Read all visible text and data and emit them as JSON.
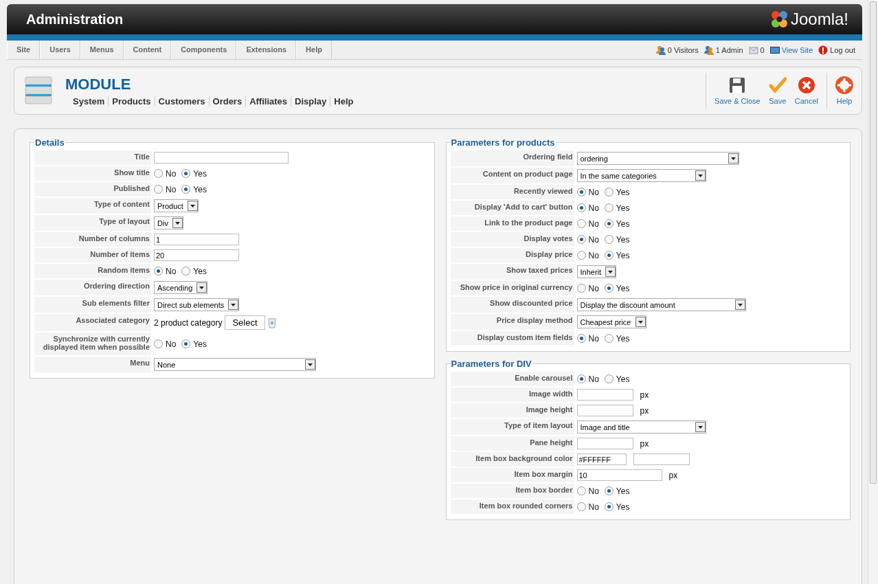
{
  "header": {
    "title": "Administration",
    "logo": "Joomla!"
  },
  "menu": [
    "Site",
    "Users",
    "Menus",
    "Content",
    "Components",
    "Extensions",
    "Help"
  ],
  "status": [
    {
      "kind": "visitors",
      "text": "0 Visitors"
    },
    {
      "kind": "admins",
      "text": "1 Admin"
    },
    {
      "kind": "messages",
      "text": "0"
    },
    {
      "kind": "viewsite",
      "text": "View Site"
    },
    {
      "kind": "logout",
      "text": "Log out"
    }
  ],
  "toolbar": {
    "title": "MODULE",
    "submenu": [
      "System",
      "Products",
      "Customers",
      "Orders",
      "Affiliates",
      "Display",
      "Help"
    ],
    "buttons": [
      {
        "kind": "save-close",
        "label": "Save & Close"
      },
      {
        "kind": "save",
        "label": "Save"
      },
      {
        "kind": "cancel",
        "label": "Cancel"
      },
      {
        "kind": "help",
        "label": "Help"
      }
    ]
  },
  "details": {
    "legend": "Details",
    "rows": [
      {
        "label": "Title",
        "kind": "text"
      },
      {
        "label": "Show title",
        "kind": "radio",
        "options": [
          {
            "label": "No",
            "selected": false
          },
          {
            "label": "Yes",
            "selected": true
          }
        ]
      },
      {
        "label": "Published",
        "kind": "radio",
        "options": [
          {
            "label": "No",
            "selected": false
          },
          {
            "label": "Yes",
            "selected": true
          }
        ]
      },
      {
        "label": "Type of content",
        "kind": "select",
        "value": "Product"
      },
      {
        "label": "Type of layout",
        "kind": "select",
        "value": "Div"
      },
      {
        "label": "Number of columns",
        "kind": "text",
        "value": "1"
      },
      {
        "label": "Number of items",
        "kind": "text",
        "value": "20"
      },
      {
        "label": "Random items",
        "kind": "radio",
        "options": [
          {
            "label": "No",
            "selected": true
          },
          {
            "label": "Yes",
            "selected": false
          }
        ]
      },
      {
        "label": "Ordering direction",
        "kind": "select",
        "value": "Ascending"
      },
      {
        "label": "Sub elements filter",
        "kind": "select",
        "value": "Direct sub elements"
      },
      {
        "label": "Associated category",
        "kind": "category",
        "value": "2 product category",
        "button": "Select"
      },
      {
        "label": "Synchronize with currently displayed item when possible",
        "kind": "radio",
        "options": [
          {
            "label": "No",
            "selected": false
          },
          {
            "label": "Yes",
            "selected": true
          }
        ]
      },
      {
        "label": "Menu",
        "kind": "select",
        "value": "None"
      }
    ]
  },
  "products": {
    "legend": "Parameters for products",
    "rows": [
      {
        "label": "Ordering field",
        "kind": "select",
        "value": "ordering"
      },
      {
        "label": "Content on product page",
        "kind": "select",
        "value": "In the same categories"
      },
      {
        "label": "Recently viewed",
        "kind": "radio",
        "options": [
          {
            "label": "No",
            "selected": true
          },
          {
            "label": "Yes",
            "selected": false
          }
        ]
      },
      {
        "label": "Display 'Add to cart' button",
        "kind": "radio",
        "options": [
          {
            "label": "No",
            "selected": true
          },
          {
            "label": "Yes",
            "selected": false
          }
        ]
      },
      {
        "label": "Link to the product page",
        "kind": "radio",
        "options": [
          {
            "label": "No",
            "selected": false
          },
          {
            "label": "Yes",
            "selected": true
          }
        ]
      },
      {
        "label": "Display votes",
        "kind": "radio",
        "options": [
          {
            "label": "No",
            "selected": true
          },
          {
            "label": "Yes",
            "selected": false
          }
        ]
      },
      {
        "label": "Display price",
        "kind": "radio",
        "options": [
          {
            "label": "No",
            "selected": false
          },
          {
            "label": "Yes",
            "selected": true
          }
        ]
      },
      {
        "label": "Show taxed prices",
        "kind": "select",
        "value": "Inherit"
      },
      {
        "label": "Show price in original currency",
        "kind": "radio",
        "options": [
          {
            "label": "No",
            "selected": false
          },
          {
            "label": "Yes",
            "selected": true
          }
        ]
      },
      {
        "label": "Show discounted price",
        "kind": "select",
        "value": "Display the discount amount"
      },
      {
        "label": "Price display method",
        "kind": "select",
        "value": "Cheapest price"
      },
      {
        "label": "Display custom item fields",
        "kind": "radio",
        "options": [
          {
            "label": "No",
            "selected": true
          },
          {
            "label": "Yes",
            "selected": false
          }
        ]
      }
    ]
  },
  "div": {
    "legend": "Parameters for DIV",
    "rows": [
      {
        "label": "Enable carousel",
        "kind": "radio",
        "options": [
          {
            "label": "No",
            "selected": true
          },
          {
            "label": "Yes",
            "selected": false
          }
        ]
      },
      {
        "label": "Image width",
        "kind": "textpx",
        "unit": "px"
      },
      {
        "label": "Image height",
        "kind": "textpx",
        "unit": "px"
      },
      {
        "label": "Type of item layout",
        "kind": "select",
        "value": "Image and title"
      },
      {
        "label": "Pane height",
        "kind": "textpx",
        "unit": "px"
      },
      {
        "label": "Item box background color",
        "kind": "color",
        "value": "#FFFFFF"
      },
      {
        "label": "Item box margin",
        "kind": "textpx",
        "value": "10",
        "unit": "px"
      },
      {
        "label": "Item box border",
        "kind": "radio",
        "options": [
          {
            "label": "No",
            "selected": false
          },
          {
            "label": "Yes",
            "selected": true
          }
        ]
      },
      {
        "label": "Item box rounded corners",
        "kind": "radio",
        "options": [
          {
            "label": "No",
            "selected": false
          },
          {
            "label": "Yes",
            "selected": true
          }
        ]
      }
    ]
  }
}
